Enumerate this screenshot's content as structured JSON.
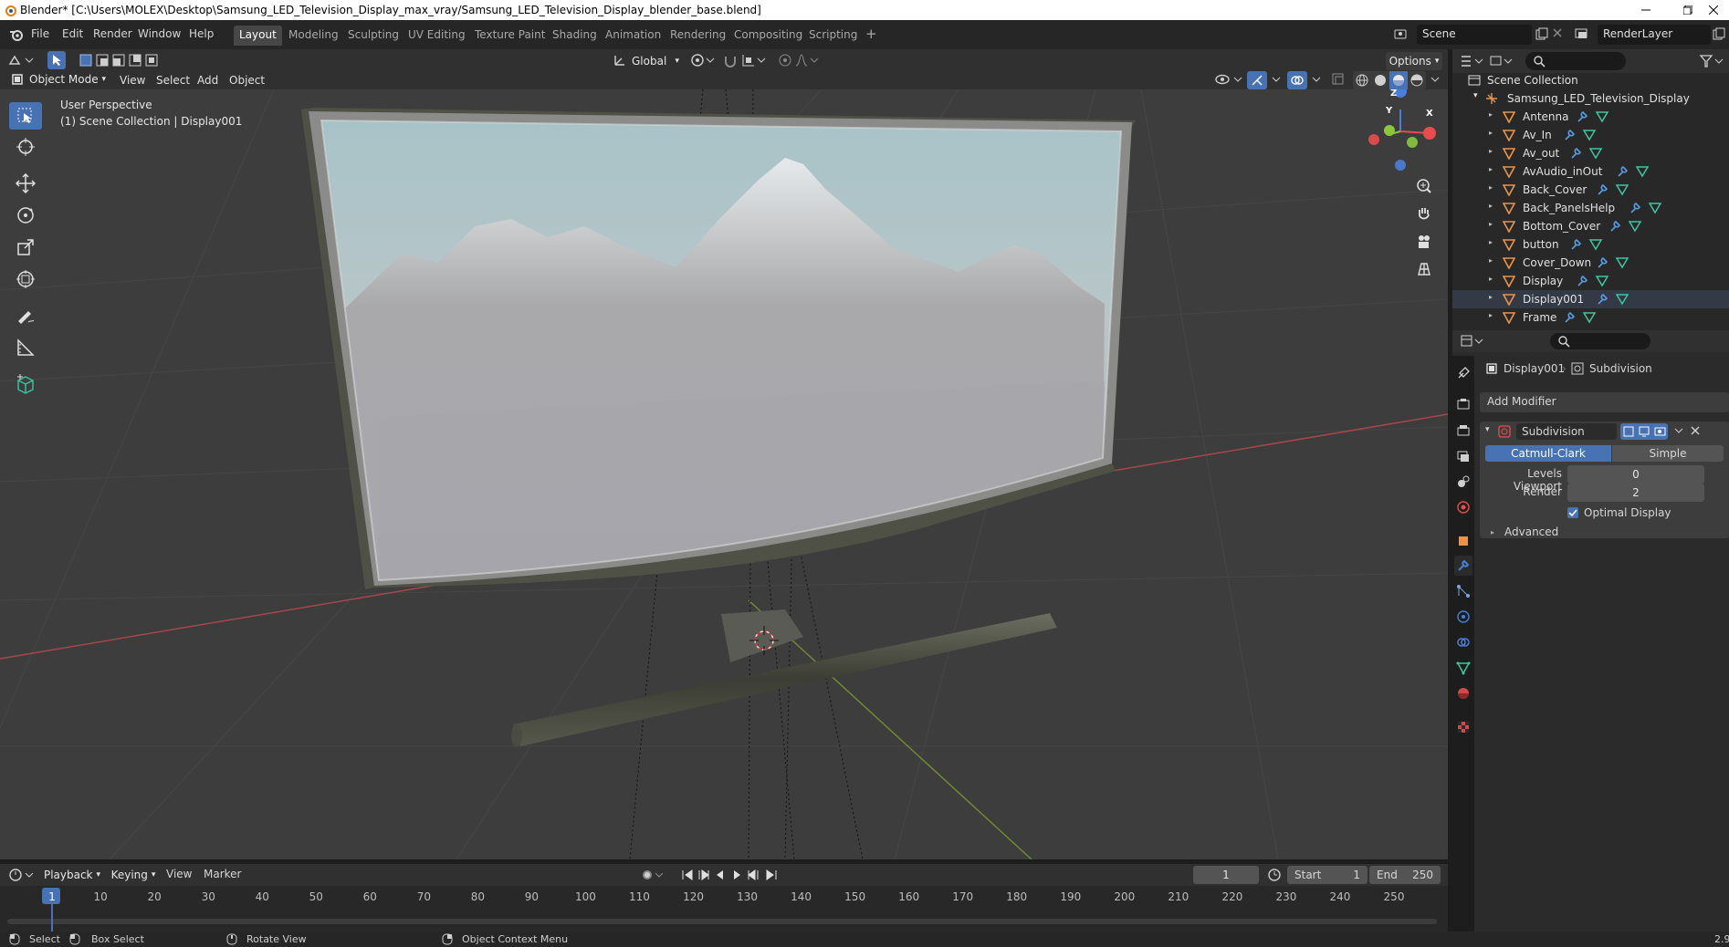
{
  "window": {
    "title": "Blender* [C:\\Users\\MOLEX\\Desktop\\Samsung_LED_Television_Display_max_vray/Samsung_LED_Television_Display_blender_base.blend]"
  },
  "menu": {
    "file": "File",
    "edit": "Edit",
    "render": "Render",
    "window": "Window",
    "help": "Help"
  },
  "workspaces": [
    "Layout",
    "Modeling",
    "Sculpting",
    "UV Editing",
    "Texture Paint",
    "Shading",
    "Animation",
    "Rendering",
    "Compositing",
    "Scripting"
  ],
  "scene_name": "Scene",
  "view_layer": "RenderLayer",
  "viewport": {
    "mode": "Object Mode",
    "menus": [
      "View",
      "Select",
      "Add",
      "Object"
    ],
    "transform_orientation": "Global",
    "options_label": "Options",
    "overlay_line1": "User Perspective",
    "overlay_line2": "(1) Scene Collection | Display001",
    "gizmo_axes": {
      "x": "X",
      "y": "Y",
      "z": "Z"
    }
  },
  "outliner": {
    "root": "Scene Collection",
    "collection": "Samsung_LED_Television_Display",
    "items": [
      "Antenna",
      "Av_In",
      "Av_out",
      "AvAudio_inOut",
      "Back_Cover",
      "Back_PanelsHelp",
      "Bottom_Cover",
      "button",
      "Cover_Down",
      "Display",
      "Display001",
      "Frame"
    ],
    "selected": "Display001"
  },
  "properties": {
    "object_name": "Display001",
    "modifier_crumb": "Subdivision",
    "add_modifier": "Add Modifier",
    "modifier": {
      "name": "Subdivision",
      "type_options": [
        "Catmull-Clark",
        "Simple"
      ],
      "selected_type": "Catmull-Clark",
      "levels_viewport_label": "Levels Viewport",
      "levels_viewport": "0",
      "render_label": "Render",
      "render": "2",
      "optimal_display_label": "Optimal Display",
      "optimal_display": true,
      "advanced_label": "Advanced"
    }
  },
  "timeline": {
    "menus": [
      "Playback",
      "Keying",
      "View",
      "Marker"
    ],
    "current_frame": "1",
    "start_label": "Start",
    "start": "1",
    "end_label": "End",
    "end": "250",
    "ticks": [
      "1",
      "10",
      "20",
      "30",
      "40",
      "50",
      "60",
      "70",
      "80",
      "90",
      "100",
      "110",
      "120",
      "130",
      "140",
      "150",
      "160",
      "170",
      "180",
      "190",
      "200",
      "210",
      "220",
      "230",
      "240",
      "250"
    ]
  },
  "statusbar": {
    "select": "Select",
    "box_select": "Box Select",
    "rotate_view": "Rotate View",
    "context_menu": "Object Context Menu",
    "version": "2.9"
  },
  "colors": {
    "accent": "#4772b3",
    "x_axis": "#e84c4c",
    "y_axis": "#8cc63f",
    "z_axis": "#4a7fd9",
    "mesh_icon": "#e8944a",
    "data_icon": "#3fc4a0"
  }
}
